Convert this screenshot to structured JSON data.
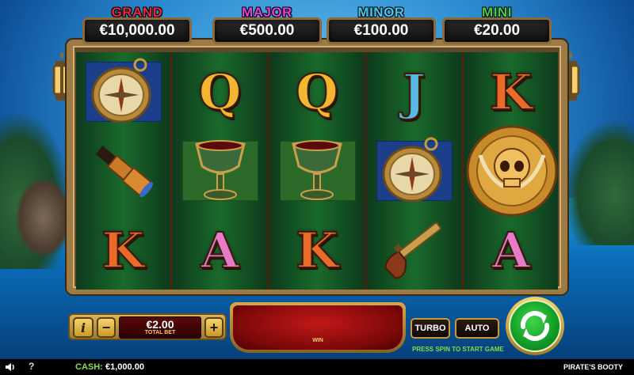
{
  "jackpots": [
    {
      "name": "GRAND",
      "amount": "€10,000.00",
      "color": "#e8283a"
    },
    {
      "name": "MAJOR",
      "amount": "€500.00",
      "color": "#e040e0"
    },
    {
      "name": "MINOR",
      "amount": "€100.00",
      "color": "#40c8f0"
    },
    {
      "name": "MINI",
      "amount": "€20.00",
      "color": "#40d040"
    }
  ],
  "reels": [
    [
      "compass",
      "spyglass",
      "K"
    ],
    [
      "Q",
      "goblet",
      "A"
    ],
    [
      "Q",
      "goblet",
      "K"
    ],
    [
      "J",
      "compass",
      "pistol"
    ],
    [
      "K",
      "skull-coin",
      "A"
    ]
  ],
  "controls": {
    "info_label": "i",
    "minus_label": "−",
    "plus_label": "+",
    "bet_value": "€2.00",
    "bet_label": "TOTAL BET",
    "win_label": "WIN",
    "turbo_label": "TURBO",
    "auto_label": "AUTO",
    "hint": "PRESS SPIN TO START GAME"
  },
  "footer": {
    "help_label": "?",
    "cash_label": "CASH:",
    "cash_value": "€1,000.00",
    "game_name": "PIRATE'S BOOTY"
  }
}
